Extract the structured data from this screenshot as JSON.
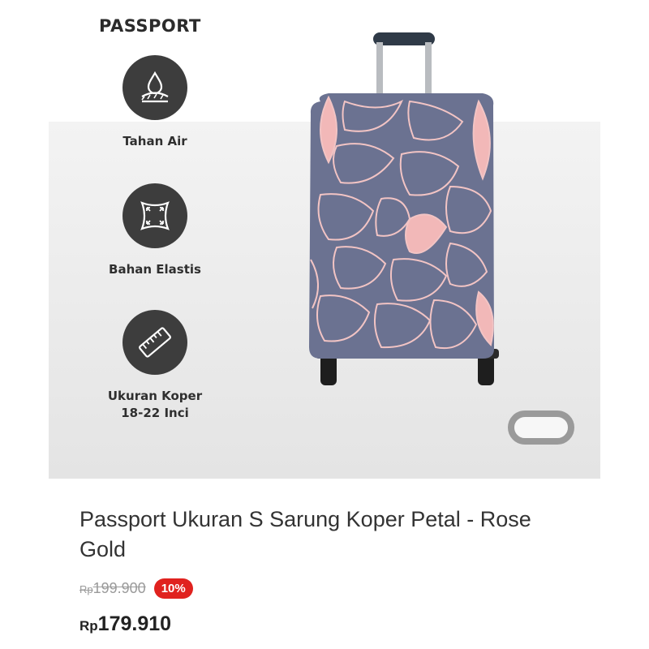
{
  "brand": {
    "name": "PASSPORT"
  },
  "features": [
    {
      "label": "Tahan Air",
      "icon": "water-drop-icon"
    },
    {
      "label": "Bahan Elastis",
      "icon": "stretch-arrows-icon"
    },
    {
      "label": "Ukuran Koper\n18-22 Inci",
      "icon": "ruler-icon"
    }
  ],
  "product": {
    "title": "Passport Ukuran S Sarung Koper Petal - Rose Gold",
    "original_price_currency": "Rp",
    "original_price": "199.900",
    "discount": "10%",
    "price_currency": "Rp",
    "price": "179.910"
  },
  "colors": {
    "cover": "#6b7291",
    "petal_accent": "#f2b8b8",
    "discount_badge": "#e0221f"
  }
}
